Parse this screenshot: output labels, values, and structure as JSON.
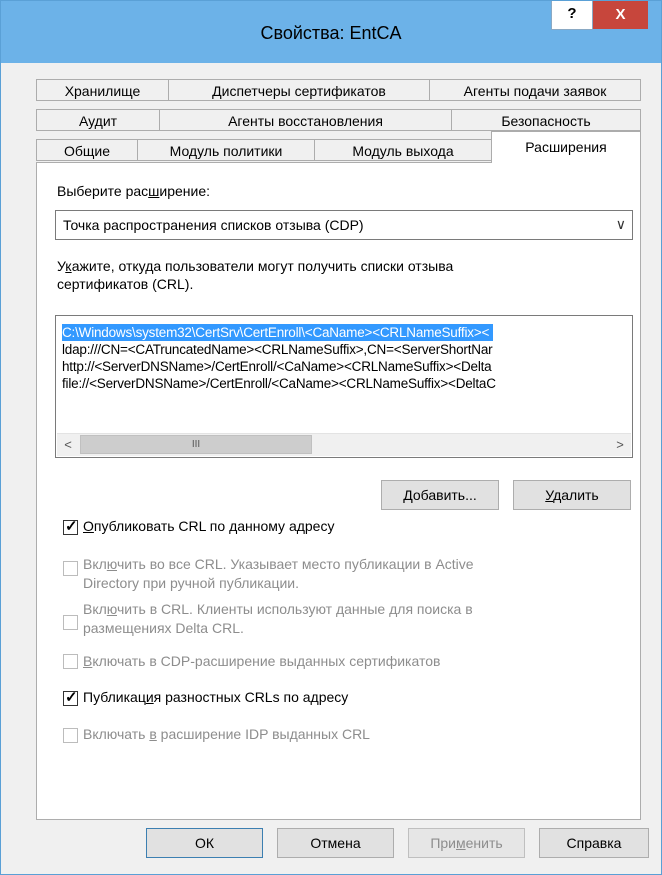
{
  "window": {
    "title": "Свойства: EntCA",
    "help_label": "?",
    "close_label": "X"
  },
  "tabs": {
    "row1": [
      "Хранилище",
      "Диспетчеры сертификатов",
      "Агенты подачи заявок"
    ],
    "row2": [
      "Аудит",
      "Агенты восстановления",
      "Безопасность"
    ],
    "row3": [
      "Общие",
      "Модуль политики",
      "Модуль выхода",
      "Расширения"
    ]
  },
  "extension": {
    "select_label_pre": "Выберите рас",
    "select_label_u": "ш",
    "select_label_post": "ирение:",
    "selected": "Точка распространения списков отзыва (CDP)",
    "hint_line1_pre": "У",
    "hint_line1_u": "к",
    "hint_line1_post": "ажите, откуда пользователи могут получить списки отзыва",
    "hint_line2": "сертификатов (CRL)."
  },
  "locations": [
    "C:\\Windows\\system32\\CertSrv\\CertEnroll\\<CaName><CRLNameSuffix><",
    "ldap:///CN=<CATruncatedName><CRLNameSuffix>,CN=<ServerShortNar",
    "http://<ServerDNSName>/CertEnroll/<CaName><CRLNameSuffix><Delta",
    "file://<ServerDNSName>/CertEnroll/<CaName><CRLNameSuffix><DeltaC"
  ],
  "scrollbar": {
    "left": "<",
    "right": ">",
    "thumb": "III"
  },
  "buttons": {
    "add_pre": "",
    "add_u": "Д",
    "add_post": "обавить...",
    "remove_pre": "",
    "remove_u": "У",
    "remove_post": "далить",
    "ok": "ОК",
    "cancel": "Отмена",
    "apply_pre": "При",
    "apply_u": "м",
    "apply_post": "енить",
    "help": "Справка"
  },
  "options": [
    {
      "pre": "",
      "u": "О",
      "post": "публиковать CRL по данному адресу",
      "checked": true,
      "enabled": true
    },
    {
      "line1_pre": "Вкл",
      "line1_u": "ю",
      "line1_post": "чить во все CRL. Указывает место публикации в Active",
      "line2": "Directory при ручной публикации.",
      "checked": false,
      "enabled": false
    },
    {
      "line1_pre": "Вкл",
      "line1_u": "ю",
      "line1_post": "чить в CRL. Клиенты используют данные для поиска в",
      "line2": "размещениях Delta CRL.",
      "checked": false,
      "enabled": false
    },
    {
      "pre": "",
      "u": "В",
      "post": "ключать в CDP-расширение выданных сертификатов",
      "checked": false,
      "enabled": false
    },
    {
      "pre": "Публикац",
      "u": "и",
      "post": "я разностных CRLs по адресу",
      "checked": true,
      "enabled": true
    },
    {
      "pre": "Включать ",
      "u": "в",
      "post": " расширение IDP выданных CRL",
      "checked": false,
      "enabled": false
    }
  ],
  "colors": {
    "titlebar": "#6cb2e8",
    "close": "#c7463c",
    "selection": "#3399ff"
  }
}
